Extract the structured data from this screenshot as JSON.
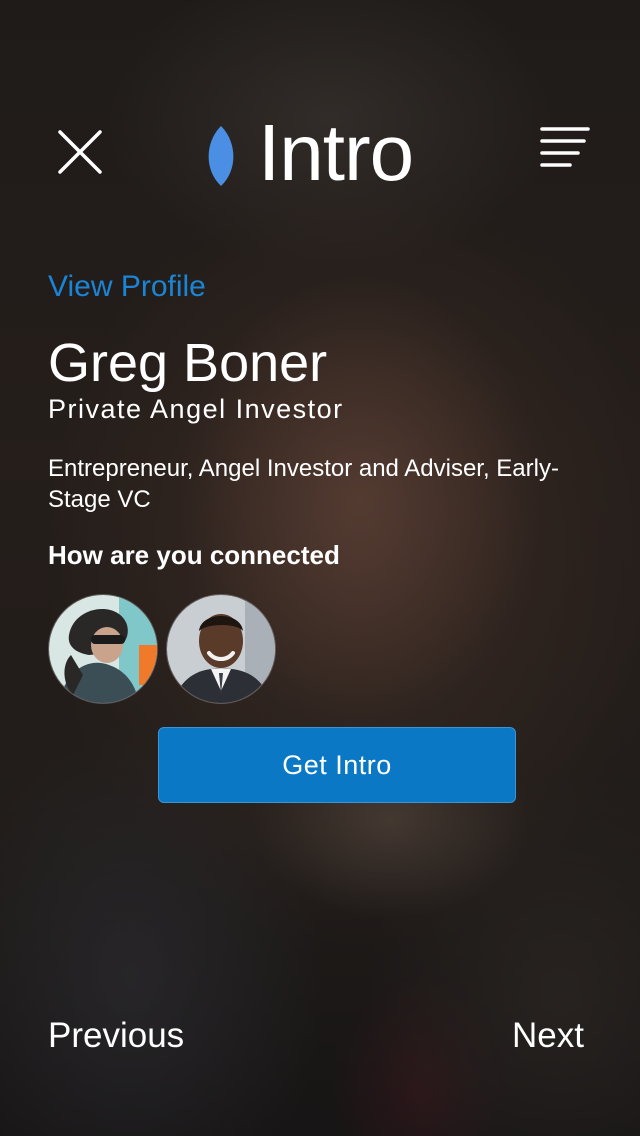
{
  "header": {
    "brand_name": "Intro",
    "close_icon": "close-icon",
    "menu_icon": "menu-lines-icon",
    "brand_mark_color": "#4a8fe3"
  },
  "profile": {
    "view_profile_link": "View Profile",
    "name": "Greg Boner",
    "role": "Private Angel Investor",
    "bio": "Entrepreneur, Angel Investor and Adviser, Early-Stage VC"
  },
  "connections": {
    "title": "How are you connected",
    "avatars": [
      {
        "icon": "avatar-photo-woman"
      },
      {
        "icon": "avatar-photo-man"
      }
    ]
  },
  "actions": {
    "get_intro_label": "Get Intro",
    "accent_color": "#0a78c5"
  },
  "footer": {
    "previous_label": "Previous",
    "next_label": "Next"
  }
}
